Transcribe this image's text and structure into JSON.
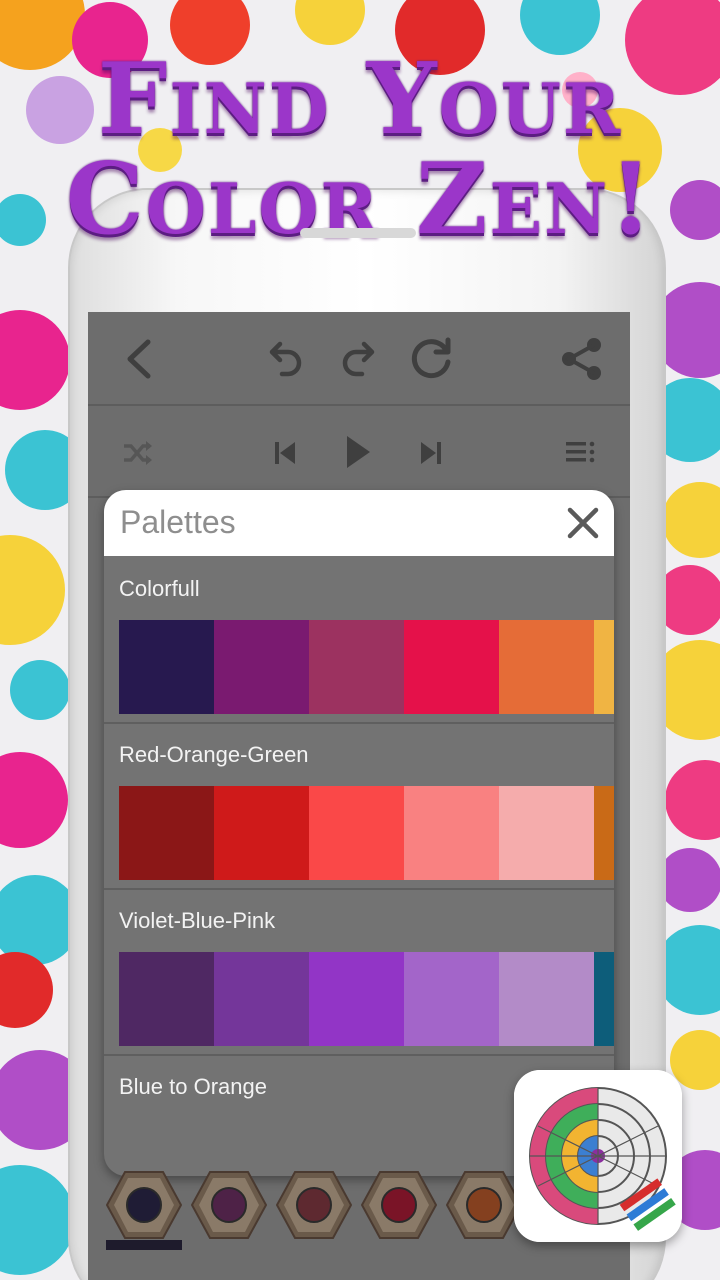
{
  "promo": {
    "line1": "Find Your",
    "line2": "Color Zen!"
  },
  "toolbar": {
    "icons": [
      "back-icon",
      "undo-icon",
      "redo-icon",
      "refresh-icon",
      "share-icon"
    ],
    "player_icons": [
      "shuffle-icon",
      "previous-icon",
      "play-icon",
      "next-icon",
      "playlist-icon"
    ]
  },
  "dialog": {
    "title": "Palettes",
    "close_icon": "close-icon",
    "palettes": [
      {
        "name": "Colorfull",
        "colors": [
          "#27194f",
          "#7a1a70",
          "#9c3260",
          "#e5114a",
          "#e56c37",
          "#f0b443"
        ]
      },
      {
        "name": "Red-Orange-Green",
        "colors": [
          "#8b1717",
          "#cf1a1a",
          "#fa4848",
          "#f98181",
          "#f5acac",
          "#c96a17"
        ]
      },
      {
        "name": "Violet-Blue-Pink",
        "colors": [
          "#4f2863",
          "#74369a",
          "#9235c6",
          "#a365c9",
          "#b38bc8",
          "#0d5d7a"
        ]
      },
      {
        "name": "Blue to Orange",
        "colors": []
      }
    ]
  },
  "selected_colors": [
    "#1f1c35",
    "#4e2247",
    "#5e2930",
    "#7a1427",
    "#84401f"
  ],
  "accent_color": "#9b36c9"
}
